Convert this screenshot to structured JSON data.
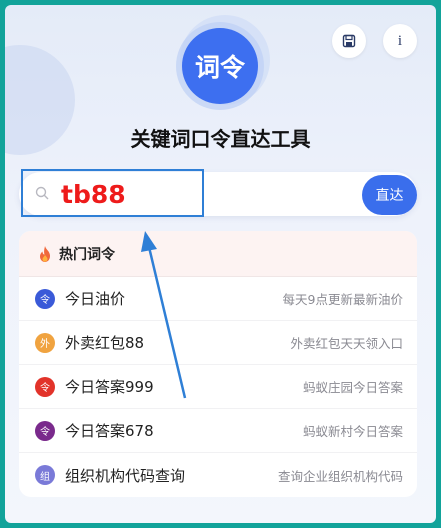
{
  "header": {
    "logo_text": "词令",
    "title": "关键词口令直达工具",
    "save_icon": "save-icon",
    "info_label": "i"
  },
  "search": {
    "value": "tb88",
    "go_label": "直达"
  },
  "hot": {
    "heading": "热门词令",
    "items": [
      {
        "badge": "令",
        "label": "今日油价",
        "desc": "每天9点更新最新油价",
        "color": "#3a5ad8"
      },
      {
        "badge": "外",
        "label": "外卖红包88",
        "desc": "外卖红包天天领入口",
        "color": "#f0a340"
      },
      {
        "badge": "令",
        "label": "今日答案999",
        "desc": "蚂蚁庄园今日答案",
        "color": "#e2332a"
      },
      {
        "badge": "令",
        "label": "今日答案678",
        "desc": "蚂蚁新村今日答案",
        "color": "#7a2a8c"
      },
      {
        "badge": "组",
        "label": "组织机构代码查询",
        "desc": "查询企业组织机构代码",
        "color": "#7a7ad8"
      }
    ]
  },
  "colors": {
    "accent": "#3a6eec",
    "search_text": "#ee1b1b",
    "annotation": "#2f7fd6"
  }
}
